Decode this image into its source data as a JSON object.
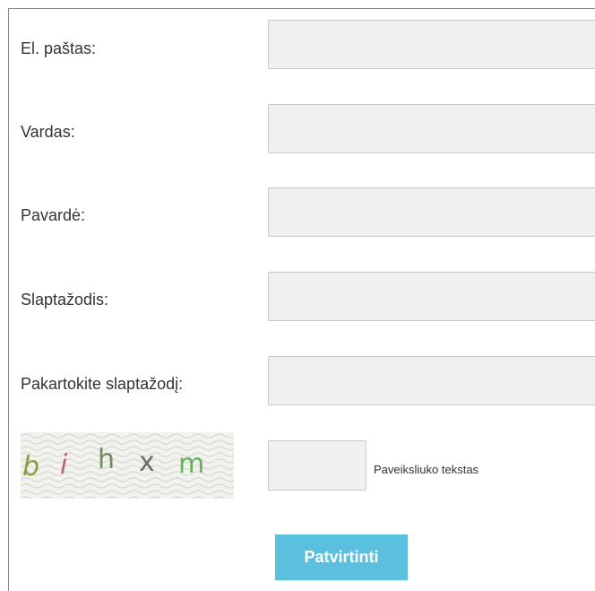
{
  "form": {
    "fields": [
      {
        "label": "El. paštas:",
        "value": ""
      },
      {
        "label": "Vardas:",
        "value": ""
      },
      {
        "label": "Pavardė:",
        "value": ""
      },
      {
        "label": "Slaptažodis:",
        "value": ""
      },
      {
        "label": "Pakartokite slaptažodį:",
        "value": ""
      }
    ],
    "captcha": {
      "image_text": "b i h x m",
      "letters": [
        "b",
        "i",
        "h",
        "x",
        "m"
      ],
      "letter_colors": [
        "#8e9a3c",
        "#c0606a",
        "#6f8f5a",
        "#6a6a6a",
        "#68b064"
      ],
      "input_value": "",
      "hint": "Paveiksliuko tekstas"
    },
    "submit_label": "Patvirtinti"
  },
  "colors": {
    "button_bg": "#5bc0de",
    "field_bg": "#f0f0f0",
    "field_border": "#c8c8c8"
  }
}
